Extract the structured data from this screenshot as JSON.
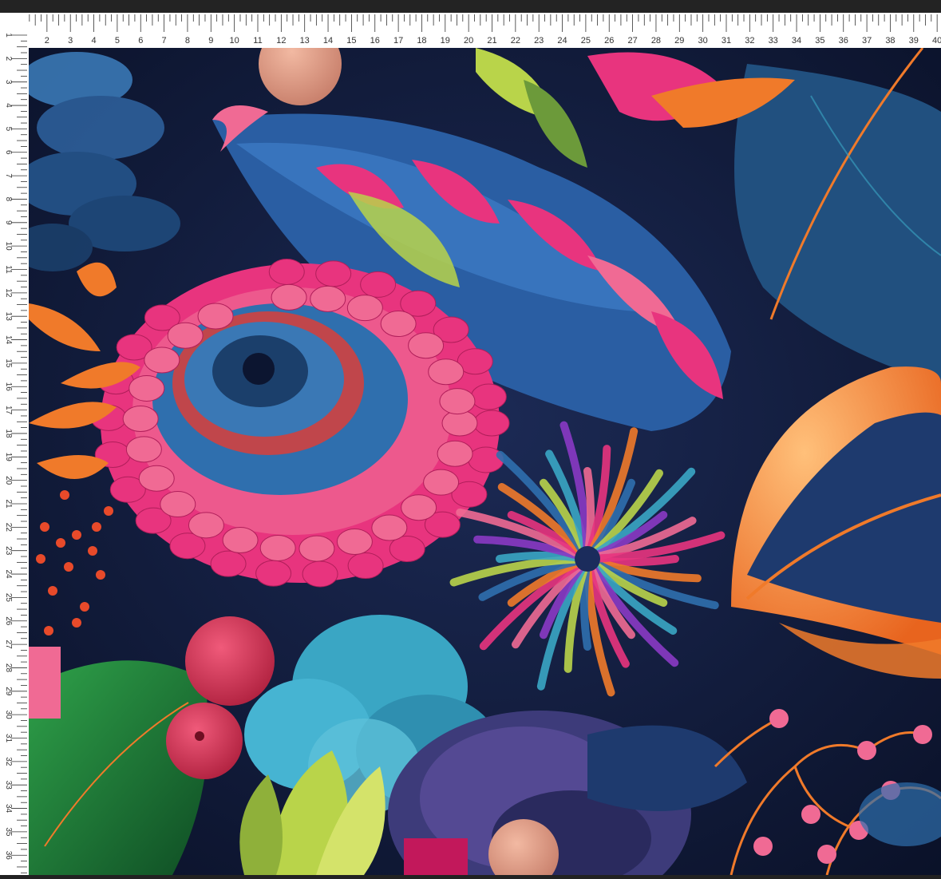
{
  "ruler": {
    "top_labels": [
      "1",
      "2",
      "3",
      "4",
      "5",
      "6",
      "7",
      "8",
      "9",
      "10",
      "11",
      "12",
      "13",
      "14",
      "15",
      "16",
      "17",
      "18",
      "19",
      "20",
      "21",
      "22",
      "23",
      "24",
      "25",
      "26",
      "27",
      "28",
      "29",
      "30",
      "31",
      "32",
      "33",
      "34",
      "35",
      "36",
      "37",
      "38",
      "39",
      "40"
    ],
    "left_labels": [
      "1",
      "2",
      "3",
      "4",
      "5",
      "6",
      "7",
      "8",
      "9",
      "10",
      "11",
      "12",
      "13",
      "14",
      "15",
      "16",
      "17",
      "18",
      "19",
      "20",
      "21",
      "22",
      "23",
      "24",
      "25",
      "26",
      "27",
      "28",
      "29",
      "30",
      "31",
      "32",
      "33",
      "34",
      "35",
      "36"
    ]
  },
  "artwork": {
    "subject": "feather-and-flower-fabric-print",
    "colors": {
      "background": "#0c1530",
      "navy": "#1b2c5c",
      "blue": "#2f6fae",
      "teal": "#3aa6c4",
      "magenta": "#e8347e",
      "pink": "#f06a94",
      "orange": "#f07a2a",
      "lime": "#b9d44a",
      "green": "#2e8a3a",
      "peach": "#e8a08a"
    }
  }
}
